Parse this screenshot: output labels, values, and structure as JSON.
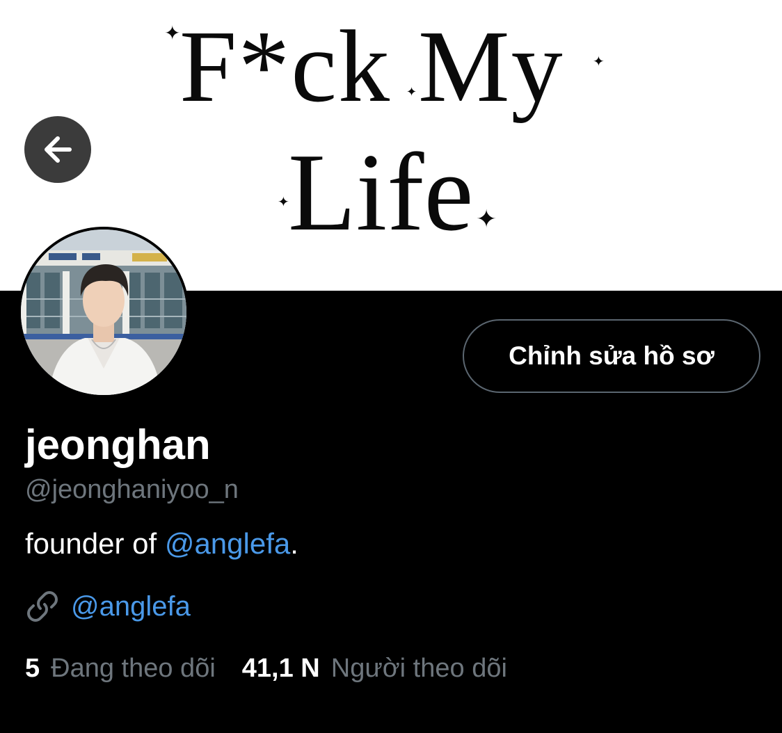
{
  "banner": {
    "line1": "F*ck My",
    "line2": "Life"
  },
  "back_button": {
    "icon": "arrow-left-icon"
  },
  "edit_profile": {
    "label": "Chỉnh sửa hồ sơ"
  },
  "profile": {
    "display_name": "jeonghan",
    "handle": "@jeonghaniyoo_n",
    "bio_prefix": "founder of ",
    "bio_mention": "@anglefa",
    "bio_suffix": ".",
    "link": "@anglefa",
    "link_icon": "link-icon"
  },
  "stats": {
    "following_count": "5",
    "following_label": "Đang theo dõi",
    "followers_count": "41,1 N",
    "followers_label": "Người theo dõi"
  },
  "colors": {
    "background": "#000000",
    "banner_background": "#ffffff",
    "accent_link": "#4a99e9",
    "muted_text": "#6e767d",
    "button_border": "#5b6670"
  }
}
